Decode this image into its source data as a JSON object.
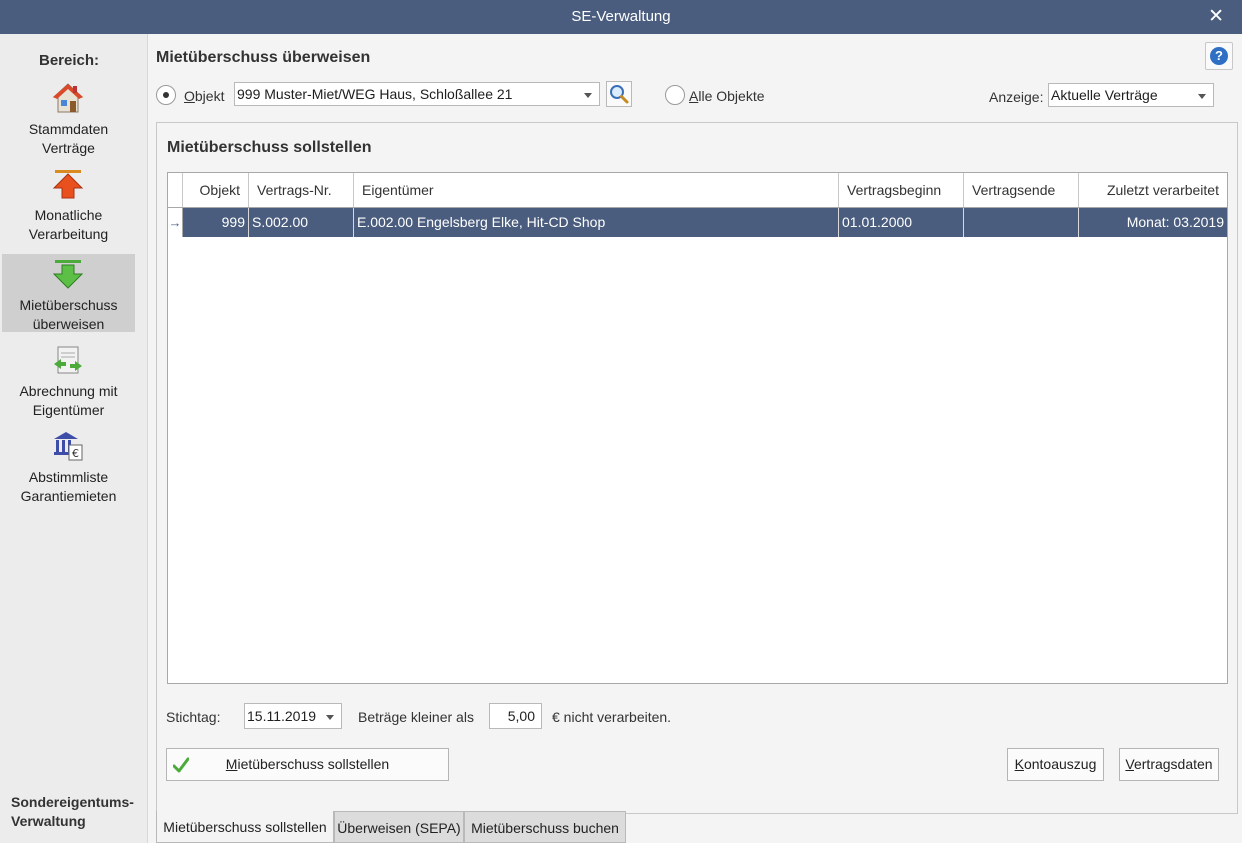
{
  "window": {
    "title": "SE-Verwaltung",
    "close_glyph": "✕"
  },
  "sidebar": {
    "heading": "Bereich:",
    "items": [
      {
        "icon": "house-icon",
        "line1": "Stammdaten",
        "line2": "Verträge",
        "active": false
      },
      {
        "icon": "arrow-up-icon",
        "line1": "Monatliche",
        "line2": "Verarbeitung",
        "active": false
      },
      {
        "icon": "arrow-down-icon",
        "line1": "Mietüberschuss",
        "line2": "überweisen",
        "active": true
      },
      {
        "icon": "document-transfer-icon",
        "line1": "Abrechnung mit",
        "line2": "Eigentümer",
        "active": false
      },
      {
        "icon": "bank-euro-icon",
        "line1": "Abstimmliste",
        "line2": "Garantiemieten",
        "active": false
      }
    ],
    "footer_line1": "Sondereigentums-",
    "footer_line2": "Verwaltung"
  },
  "header": {
    "title": "Mietüberschuss überweisen",
    "help_glyph": "?",
    "objekt_label_u": "O",
    "objekt_label_rest": "bjekt",
    "objekt_value": "999 Muster-Miet/WEG Haus, Schloßallee 21",
    "alle_label_u": "A",
    "alle_label_rest": "lle Objekte",
    "anzeige_label": "Anzeige:",
    "anzeige_value": "Aktuelle Verträge"
  },
  "panel": {
    "title": "Mietüberschuss sollstellen",
    "columns": [
      "Objekt",
      "Vertrags-Nr.",
      "Eigentümer",
      "Vertragsbeginn",
      "Vertragsende",
      "Zuletzt verarbeitet"
    ],
    "rows": [
      {
        "objekt": "999",
        "vertrag": "S.002.00",
        "eigentuemer": "E.002.00 Engelsberg Elke, Hit-CD Shop",
        "beginn": "01.01.2000",
        "ende": "",
        "zuletzt": "Monat: 03.2019"
      }
    ],
    "row_indicator": "→",
    "stichtag_label": "Stichtag:",
    "stichtag_value": "15.11.2019",
    "betraege_label": "Beträge kleiner als",
    "betraege_value": "5,00",
    "betraege_suffix": "€ nicht verarbeiten.",
    "sollstellen_btn_u": "M",
    "sollstellen_btn_rest": "ietüberschuss sollstellen",
    "konto_btn_u": "K",
    "konto_btn_rest": "ontoauszug",
    "vertrag_btn_u": "V",
    "vertrag_btn_rest": "ertragsdaten"
  },
  "tabs": [
    "Mietüberschuss sollstellen",
    "Überweisen (SEPA)",
    "Mietüberschuss buchen"
  ],
  "colors": {
    "titlebar": "#4a5d7e",
    "selection": "#4a5d7e",
    "active_nav": "#cfcfcf"
  }
}
